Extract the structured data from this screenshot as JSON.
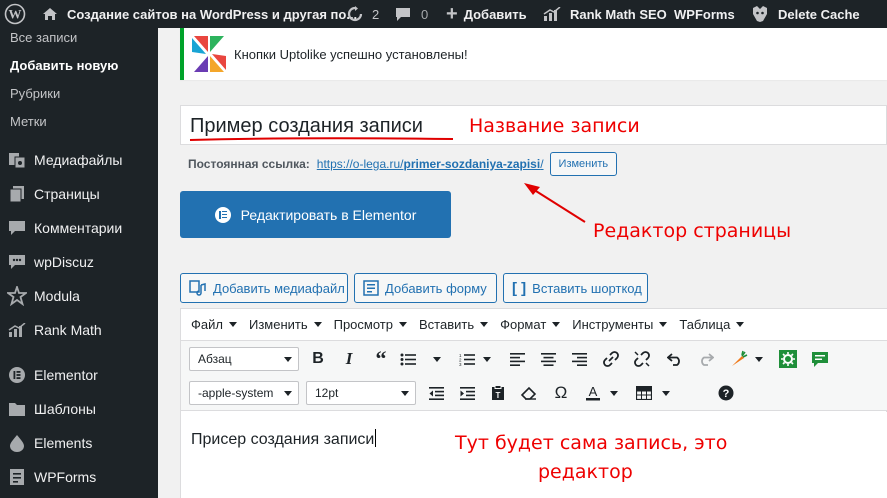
{
  "adminbar": {
    "site_title": "Создание сайтов на WordPress и другая по...",
    "updates_count": "2",
    "comments_count": "0",
    "new_label": "Добавить",
    "rankmath_label": "Rank Math SEO",
    "wpforms_label": "WPForms",
    "delete_cache_label": "Delete Cache"
  },
  "sidebar": {
    "submenu": [
      "Все записи",
      "Добавить новую",
      "Рубрики",
      "Метки"
    ],
    "menu": [
      {
        "label": "Медиафайлы",
        "icon": "media-icon"
      },
      {
        "label": "Страницы",
        "icon": "pages-icon"
      },
      {
        "label": "Комментарии",
        "icon": "comments-icon"
      },
      {
        "label": "wpDiscuz",
        "icon": "wpdiscuz-icon"
      },
      {
        "label": "Modula",
        "icon": "modula-icon"
      },
      {
        "label": "Rank Math",
        "icon": "rankmath-icon"
      },
      {
        "label": "Elementor",
        "icon": "elementor-icon"
      },
      {
        "label": "Шаблоны",
        "icon": "templates-icon"
      },
      {
        "label": "Elements",
        "icon": "elements-icon"
      },
      {
        "label": "WPForms",
        "icon": "wpforms-icon"
      }
    ]
  },
  "notice": {
    "message": "Кнопки Uptolike успешно установлены!"
  },
  "post": {
    "title": "Пример создания записи",
    "permalink_label": "Постоянная ссылка:",
    "permalink_base": "https://o-lega.ru/",
    "permalink_slug": "primer-sozdaniya-zapisi",
    "permalink_trailing": "/",
    "permalink_edit": "Изменить",
    "elementor_button": "Редактировать в Elementor"
  },
  "media_buttons": {
    "add_media": "Добавить медиафайл",
    "add_form": "Добавить форму",
    "add_shortcode": "Вставить шорткод"
  },
  "editor": {
    "menubar": [
      "Файл",
      "Изменить",
      "Просмотр",
      "Вставить",
      "Формат",
      "Инструменты",
      "Таблица"
    ],
    "format_select": "Абзац",
    "font_family_select": "-apple-system",
    "font_size_select": "12pt",
    "content_text": "Присер создания записи"
  },
  "annotations": {
    "title_note": "Название записи",
    "editor_note": "Редактор страницы",
    "content_note_line1": "Тут будет сама запись, это",
    "content_note_line2": "редактор"
  },
  "colors": {
    "accent": "#2271b1",
    "annotation": "#e00000",
    "notice_border": "#00a32a",
    "adminbar_bg": "#1d2327"
  }
}
